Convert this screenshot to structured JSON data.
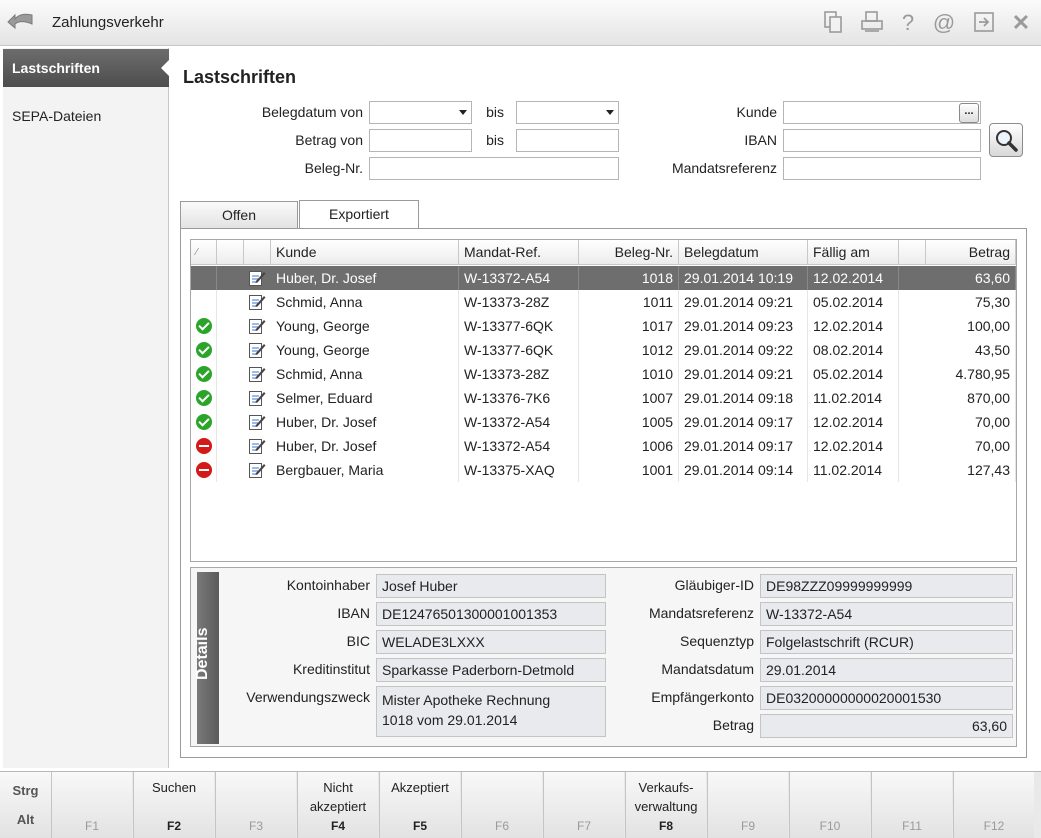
{
  "window": {
    "title": "Zahlungsverkehr",
    "toolbar_icons": [
      "copy-icon",
      "print-icon",
      "help-icon",
      "email-icon",
      "export-icon",
      "close-icon"
    ],
    "help_glyph": "?",
    "at_glyph": "@",
    "close_glyph": "✕"
  },
  "sidebar": {
    "items": [
      {
        "label": "Lastschriften",
        "active": true
      },
      {
        "label": "SEPA-Dateien",
        "active": false
      }
    ]
  },
  "main": {
    "title": "Lastschriften",
    "filters": {
      "belegdatum_von_label": "Belegdatum von",
      "bis1_label": "bis",
      "betrag_von_label": "Betrag von",
      "bis2_label": "bis",
      "beleg_nr_label": "Beleg-Nr.",
      "kunde_label": "Kunde",
      "iban_label": "IBAN",
      "mandatsreferenz_label": "Mandatsreferenz",
      "dots_label": "..."
    },
    "tabs": [
      {
        "label": "Offen",
        "active": false
      },
      {
        "label": "Exportiert",
        "active": true
      }
    ],
    "grid": {
      "sort_glyph": "⁄",
      "columns": [
        "Kunde",
        "Mandat-Ref.",
        "Beleg-Nr.",
        "Belegdatum",
        "Fällig am",
        "",
        "Betrag"
      ],
      "rows": [
        {
          "status": "none",
          "kunde": "Huber, Dr. Josef",
          "mandat": "W-13372-A54",
          "beleg": "1018",
          "datum": "29.01.2014 10:19",
          "faellig": "12.02.2014",
          "betrag": "63,60",
          "selected": true
        },
        {
          "status": "none",
          "kunde": "Schmid, Anna",
          "mandat": "W-13373-28Z",
          "beleg": "1011",
          "datum": "29.01.2014 09:21",
          "faellig": "05.02.2014",
          "betrag": "75,30"
        },
        {
          "status": "ok",
          "kunde": "Young, George",
          "mandat": "W-13377-6QK",
          "beleg": "1017",
          "datum": "29.01.2014 09:23",
          "faellig": "12.02.2014",
          "betrag": "100,00"
        },
        {
          "status": "ok",
          "kunde": "Young, George",
          "mandat": "W-13377-6QK",
          "beleg": "1012",
          "datum": "29.01.2014 09:22",
          "faellig": "08.02.2014",
          "betrag": "43,50"
        },
        {
          "status": "ok",
          "kunde": "Schmid, Anna",
          "mandat": "W-13373-28Z",
          "beleg": "1010",
          "datum": "29.01.2014 09:21",
          "faellig": "05.02.2014",
          "betrag": "4.780,95"
        },
        {
          "status": "ok",
          "kunde": "Selmer, Eduard",
          "mandat": "W-13376-7K6",
          "beleg": "1007",
          "datum": "29.01.2014 09:18",
          "faellig": "11.02.2014",
          "betrag": "870,00"
        },
        {
          "status": "ok",
          "kunde": "Huber, Dr. Josef",
          "mandat": "W-13372-A54",
          "beleg": "1005",
          "datum": "29.01.2014 09:17",
          "faellig": "12.02.2014",
          "betrag": "70,00"
        },
        {
          "status": "rejected",
          "kunde": "Huber, Dr. Josef",
          "mandat": "W-13372-A54",
          "beleg": "1006",
          "datum": "29.01.2014 09:17",
          "faellig": "12.02.2014",
          "betrag": "70,00"
        },
        {
          "status": "rejected",
          "kunde": "Bergbauer, Maria",
          "mandat": "W-13375-XAQ",
          "beleg": "1001",
          "datum": "29.01.2014 09:14",
          "faellig": "11.02.2014",
          "betrag": "127,43"
        }
      ]
    },
    "details": {
      "tab_label": "Details",
      "kontoinhaber_label": "Kontoinhaber",
      "kontoinhaber": "Josef Huber",
      "iban_label": "IBAN",
      "iban": "DE12476501300001001353",
      "bic_label": "BIC",
      "bic": "WELADE3LXXX",
      "kreditinstitut_label": "Kreditinstitut",
      "kreditinstitut": "Sparkasse Paderborn-Detmold",
      "verwendungszweck_label": "Verwendungszweck",
      "verwendungszweck_line1": "Mister Apotheke Rechnung",
      "verwendungszweck_line2": "1018 vom 29.01.2014",
      "glaeubiger_id_label": "Gläubiger-ID",
      "glaeubiger_id": "DE98ZZZ09999999999",
      "mandatsreferenz_label": "Mandatsreferenz",
      "mandatsreferenz": "W-13372-A54",
      "sequenztyp_label": "Sequenztyp",
      "sequenztyp": "Folgelastschrift (RCUR)",
      "mandatsdatum_label": "Mandatsdatum",
      "mandatsdatum": "29.01.2014",
      "empfaengerkonto_label": "Empfängerkonto",
      "empfaengerkonto": "DE03200000000020001530",
      "betrag_label": "Betrag",
      "betrag": "63,60"
    }
  },
  "fkeys": {
    "modifier_top": "Strg",
    "modifier_bottom": "Alt",
    "keys": [
      {
        "key": "F1",
        "label": "",
        "enabled": false
      },
      {
        "key": "F2",
        "label": "Suchen",
        "enabled": true
      },
      {
        "key": "F3",
        "label": "",
        "enabled": false
      },
      {
        "key": "F4",
        "label": "Nicht akzeptiert",
        "enabled": true
      },
      {
        "key": "F5",
        "label": "Akzeptiert",
        "enabled": true
      },
      {
        "key": "F6",
        "label": "",
        "enabled": false
      },
      {
        "key": "F7",
        "label": "",
        "enabled": false
      },
      {
        "key": "F8",
        "label": "Verkaufs-verwaltung",
        "enabled": true
      },
      {
        "key": "F9",
        "label": "",
        "enabled": false
      },
      {
        "key": "F10",
        "label": "",
        "enabled": false
      },
      {
        "key": "F11",
        "label": "",
        "enabled": false
      },
      {
        "key": "F12",
        "label": "",
        "enabled": false
      }
    ]
  },
  "colors": {
    "accent_dark": "#5e5e5e",
    "ok_green": "#2aa52a",
    "reject_red": "#d41919"
  }
}
